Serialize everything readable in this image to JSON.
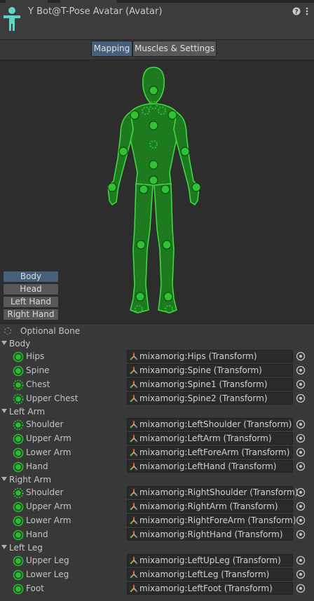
{
  "header": {
    "title": "Y Bot@T-Pose Avatar (Avatar)",
    "help_icon": "help-icon",
    "menu_icon": "kebab-menu-icon"
  },
  "tabs": [
    {
      "label": "Mapping",
      "active": true
    },
    {
      "label": "Muscles & Settings",
      "active": false
    }
  ],
  "body_parts": [
    {
      "label": "Body",
      "active": true
    },
    {
      "label": "Head",
      "active": false
    },
    {
      "label": "Left Hand",
      "active": false
    },
    {
      "label": "Right Hand",
      "active": false
    }
  ],
  "legend": {
    "label": "Optional Bone"
  },
  "groups": [
    {
      "label": "Body",
      "bones": [
        {
          "label": "Hips",
          "value": "mixamorig:Hips (Transform)",
          "optional": false
        },
        {
          "label": "Spine",
          "value": "mixamorig:Spine (Transform)",
          "optional": false
        },
        {
          "label": "Chest",
          "value": "mixamorig:Spine1 (Transform)",
          "optional": true
        },
        {
          "label": "Upper Chest",
          "value": "mixamorig:Spine2 (Transform)",
          "optional": true
        }
      ]
    },
    {
      "label": "Left Arm",
      "bones": [
        {
          "label": "Shoulder",
          "value": "mixamorig:LeftShoulder (Transform)",
          "optional": true
        },
        {
          "label": "Upper Arm",
          "value": "mixamorig:LeftArm (Transform)",
          "optional": false
        },
        {
          "label": "Lower Arm",
          "value": "mixamorig:LeftForeArm (Transform)",
          "optional": false
        },
        {
          "label": "Hand",
          "value": "mixamorig:LeftHand (Transform)",
          "optional": false
        }
      ]
    },
    {
      "label": "Right Arm",
      "bones": [
        {
          "label": "Shoulder",
          "value": "mixamorig:RightShoulder (Transform)",
          "optional": true
        },
        {
          "label": "Upper Arm",
          "value": "mixamorig:RightArm (Transform)",
          "optional": false
        },
        {
          "label": "Lower Arm",
          "value": "mixamorig:RightForeArm (Transform)",
          "optional": false
        },
        {
          "label": "Hand",
          "value": "mixamorig:RightHand (Transform)",
          "optional": false
        }
      ]
    },
    {
      "label": "Left Leg",
      "bones": [
        {
          "label": "Upper Leg",
          "value": "mixamorig:LeftUpLeg (Transform)",
          "optional": false
        },
        {
          "label": "Lower Leg",
          "value": "mixamorig:LeftLeg (Transform)",
          "optional": false
        },
        {
          "label": "Foot",
          "value": "mixamorig:LeftFoot (Transform)",
          "optional": false
        }
      ]
    }
  ],
  "colors": {
    "accent_green": "#22c22a",
    "active_button": "#46607c",
    "avatar_icon": "#5fd6c8"
  }
}
